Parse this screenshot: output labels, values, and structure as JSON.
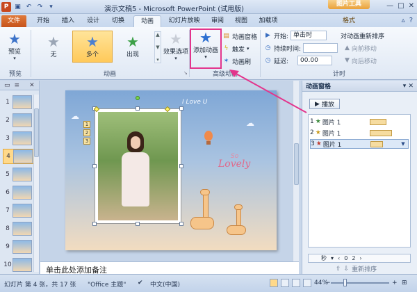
{
  "titlebar": {
    "app_badge": "P",
    "title": "演示文稿5 - Microsoft PowerPoint (试用版)",
    "context_tools": "图片工具",
    "min": "—",
    "max": "□",
    "close": "✕"
  },
  "tabs": {
    "file": "文件",
    "home": "开始",
    "insert": "插入",
    "design": "设计",
    "transitions": "切换",
    "animations": "动画",
    "slideshow": "幻灯片放映",
    "review": "审阅",
    "view": "视图",
    "addins": "加载项",
    "format": "格式"
  },
  "ribbon": {
    "preview_label": "预览",
    "preview_group": "预览",
    "anim_none": "无",
    "anim_multi": "多个",
    "anim_appear": "出现",
    "effect_options": "效果选项",
    "anim_group": "动画",
    "add_animation": "添加动画",
    "anim_pane": "动画窗格",
    "trigger": "触发",
    "anim_painter": "动画刷",
    "advanced_group": "高级动画",
    "start_label": "开始:",
    "start_value": "单击时",
    "duration_label": "持续时间:",
    "duration_value": "",
    "delay_label": "延迟:",
    "delay_value": "00.00",
    "timing_group": "计时",
    "reorder_title": "对动画重新排序",
    "move_earlier": "向前移动",
    "move_later": "向后移动"
  },
  "slides_pane": {
    "thumbs": [
      "1",
      "2",
      "3",
      "4",
      "5",
      "6",
      "7",
      "8",
      "9",
      "10"
    ],
    "selected": "4"
  },
  "slide": {
    "text_love": "I Love U",
    "text_lovely": "Lovely",
    "text_so": "So",
    "anim_tags": [
      "1",
      "2",
      "3"
    ]
  },
  "notes": {
    "placeholder": "单击此处添加备注"
  },
  "anim_pane": {
    "title": "动画窗格",
    "play": "播放",
    "items": [
      {
        "num": "1",
        "name": "图片 1"
      },
      {
        "num": "2",
        "name": "图片 1"
      },
      {
        "num": "3",
        "name": "图片 1"
      }
    ],
    "seconds_label": "秒",
    "timeline_0": "0",
    "timeline_2": "2",
    "reorder_label": "重新排序"
  },
  "statusbar": {
    "slide_info": "幻灯片 第 4 张，共 17 张",
    "theme": "\"Office 主题\"",
    "language": "中文(中国)",
    "zoom": "44%"
  },
  "colors": {
    "accent_highlight": "#e3348c",
    "file_tab": "#c6521b",
    "selected_anim": "#ffc95a"
  }
}
